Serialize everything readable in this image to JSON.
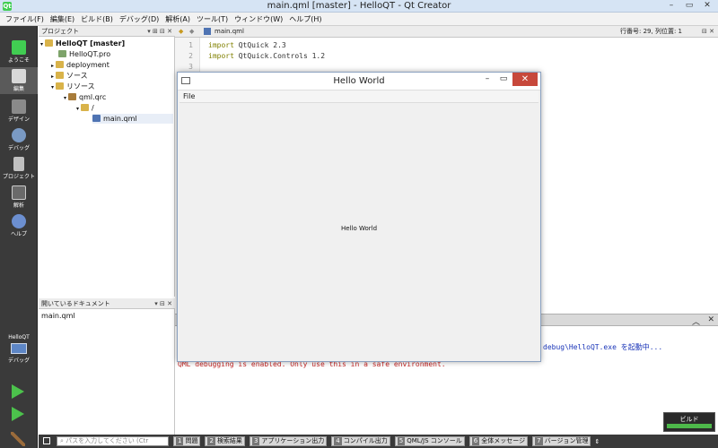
{
  "window": {
    "title": "main.qml [master] - HelloQT - Qt Creator",
    "logo_text": "Qt",
    "controls": [
      "–",
      "▭",
      "✕"
    ]
  },
  "menu": [
    "ファイル(F)",
    "編集(E)",
    "ビルド(B)",
    "デバッグ(D)",
    "解析(A)",
    "ツール(T)",
    "ウィンドウ(W)",
    "ヘルプ(H)"
  ],
  "modes": [
    {
      "label": "ようこそ",
      "icon": "qt-logo-icon",
      "color": "#41cd52"
    },
    {
      "label": "編集",
      "icon": "edit-icon",
      "color": "#d8d8d8"
    },
    {
      "label": "デザイン",
      "icon": "design-icon",
      "color": "#8a8a8a"
    },
    {
      "label": "デバッグ",
      "icon": "debug-icon",
      "color": "#7a9ac4"
    },
    {
      "label": "プロジェクト",
      "icon": "project-icon",
      "color": "#c0c0c0"
    },
    {
      "label": "解析",
      "icon": "analyze-icon",
      "color": "#6a6a6a"
    },
    {
      "label": "ヘルプ",
      "icon": "help-icon",
      "color": "#6c8fd0"
    }
  ],
  "kit": {
    "name": "HelloQT",
    "mode": "デバッグ"
  },
  "project_panel": {
    "title": "プロジェクト",
    "tree": [
      {
        "label": "HelloQT [master]",
        "level": 0,
        "bold": true,
        "icon_color": "#d9b34a"
      },
      {
        "label": "HelloQT.pro",
        "level": 1,
        "icon_color": "#7da36a"
      },
      {
        "label": "deployment",
        "level": 1,
        "icon_color": "#d9b34a"
      },
      {
        "label": "ソース",
        "level": 1,
        "icon_color": "#d9b34a"
      },
      {
        "label": "リソース",
        "level": 1,
        "icon_color": "#d9b34a"
      },
      {
        "label": "qml.qrc",
        "level": 2,
        "icon_color": "#a87c3a"
      },
      {
        "label": "/",
        "level": 3,
        "icon_color": "#d9b34a"
      },
      {
        "label": "main.qml",
        "level": 4,
        "icon_color": "#4f74b3",
        "selected": true
      }
    ]
  },
  "open_docs": {
    "title": "開いているドキュメント",
    "items": [
      "main.qml"
    ]
  },
  "editor": {
    "file": "main.qml",
    "position": "行番号: 29, 列位置: 1",
    "lines": [
      {
        "num": "1",
        "kw": "import",
        "rest": " QtQuick 2.3"
      },
      {
        "num": "2",
        "kw": "import",
        "rest": " QtQuick.Controls 1.2"
      },
      {
        "num": "3",
        "kw": "",
        "rest": ""
      }
    ]
  },
  "output": {
    "lines": [
      {
        "text": "debug\\HelloQT.exe を起動中...",
        "color": "#1a35b8"
      },
      {
        "text": "QML debugging is enabled. Only use this in a safe environment.",
        "color": "#c42626"
      }
    ]
  },
  "statusbar": {
    "search_placeholder": "パスを入力してください (Ctr",
    "tabs": [
      {
        "num": "1",
        "label": "問題"
      },
      {
        "num": "2",
        "label": "検索結果"
      },
      {
        "num": "3",
        "label": "アプリケーション出力"
      },
      {
        "num": "4",
        "label": "コンパイル出力"
      },
      {
        "num": "5",
        "label": "QML/JS コンソール"
      },
      {
        "num": "6",
        "label": "全体メッセージ"
      },
      {
        "num": "7",
        "label": "バージョン管理"
      }
    ],
    "build_label": "ビルド"
  },
  "dialog": {
    "title": "Hello World",
    "menu": "File",
    "content_text": "Hello World",
    "controls": [
      "–",
      "▭",
      "✕"
    ]
  }
}
